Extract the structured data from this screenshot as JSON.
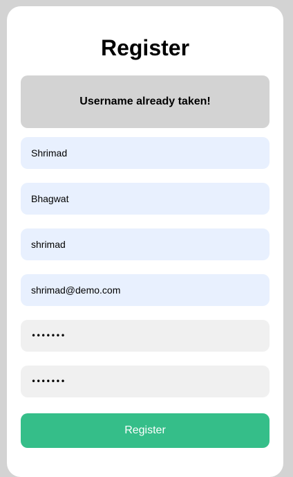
{
  "form": {
    "title": "Register",
    "alert": "Username already taken!",
    "fields": {
      "first_name": "Shrimad",
      "last_name": "Bhagwat",
      "username": "shrimad",
      "email": "shrimad@demo.com",
      "password": "demo123",
      "confirm_password": "demo123"
    },
    "submit_label": "Register"
  },
  "colors": {
    "page_background": "#d3d3d3",
    "card_background": "#ffffff",
    "alert_background": "#d3d3d3",
    "autofill_field": "#e8f0fe",
    "plain_field": "#f0f0f0",
    "submit_button": "#35be89"
  }
}
